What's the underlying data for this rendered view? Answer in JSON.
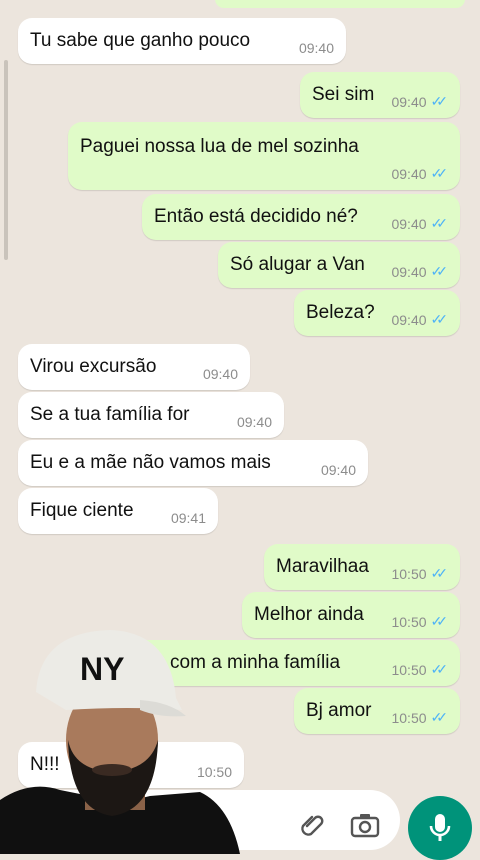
{
  "messages": [
    {
      "dir": "in",
      "text": "Tu sabe que ganho pouco",
      "time": "09:40"
    },
    {
      "dir": "out",
      "text": "Sei sim",
      "time": "09:40"
    },
    {
      "dir": "out",
      "text": "Paguei nossa lua de mel sozinha",
      "time": "09:40"
    },
    {
      "dir": "out",
      "text": "Então está decidido né?",
      "time": "09:40"
    },
    {
      "dir": "out",
      "text": "Só alugar a Van",
      "time": "09:40"
    },
    {
      "dir": "out",
      "text": "Beleza?",
      "time": "09:40"
    },
    {
      "dir": "in",
      "text": "Virou excursão",
      "time": "09:40"
    },
    {
      "dir": "in",
      "text": "Se a tua família for",
      "time": "09:40"
    },
    {
      "dir": "in",
      "text": "Eu e a mãe não vamos mais",
      "time": "09:40"
    },
    {
      "dir": "in",
      "text": "Fique ciente",
      "time": "09:41"
    },
    {
      "dir": "out",
      "text": "Maravilhaa",
      "time": "10:50"
    },
    {
      "dir": "out",
      "text": "Melhor ainda",
      "time": "10:50"
    },
    {
      "dir": "out",
      "text": "Vou com a minha família",
      "time": "10:50"
    },
    {
      "dir": "out",
      "text": "Bj amor",
      "time": "10:50"
    },
    {
      "dir": "in",
      "text": "N!!!",
      "time": "10:50"
    }
  ],
  "cap_text": "NY",
  "icons": {
    "attach": "paperclip-icon",
    "camera": "camera-icon",
    "mic": "microphone-icon",
    "ticks": "double-check-icon"
  },
  "colors": {
    "incoming": "#ffffff",
    "outgoing": "#e0fbc8",
    "ticks": "#4fb3f7",
    "mic_button": "#00937a"
  }
}
